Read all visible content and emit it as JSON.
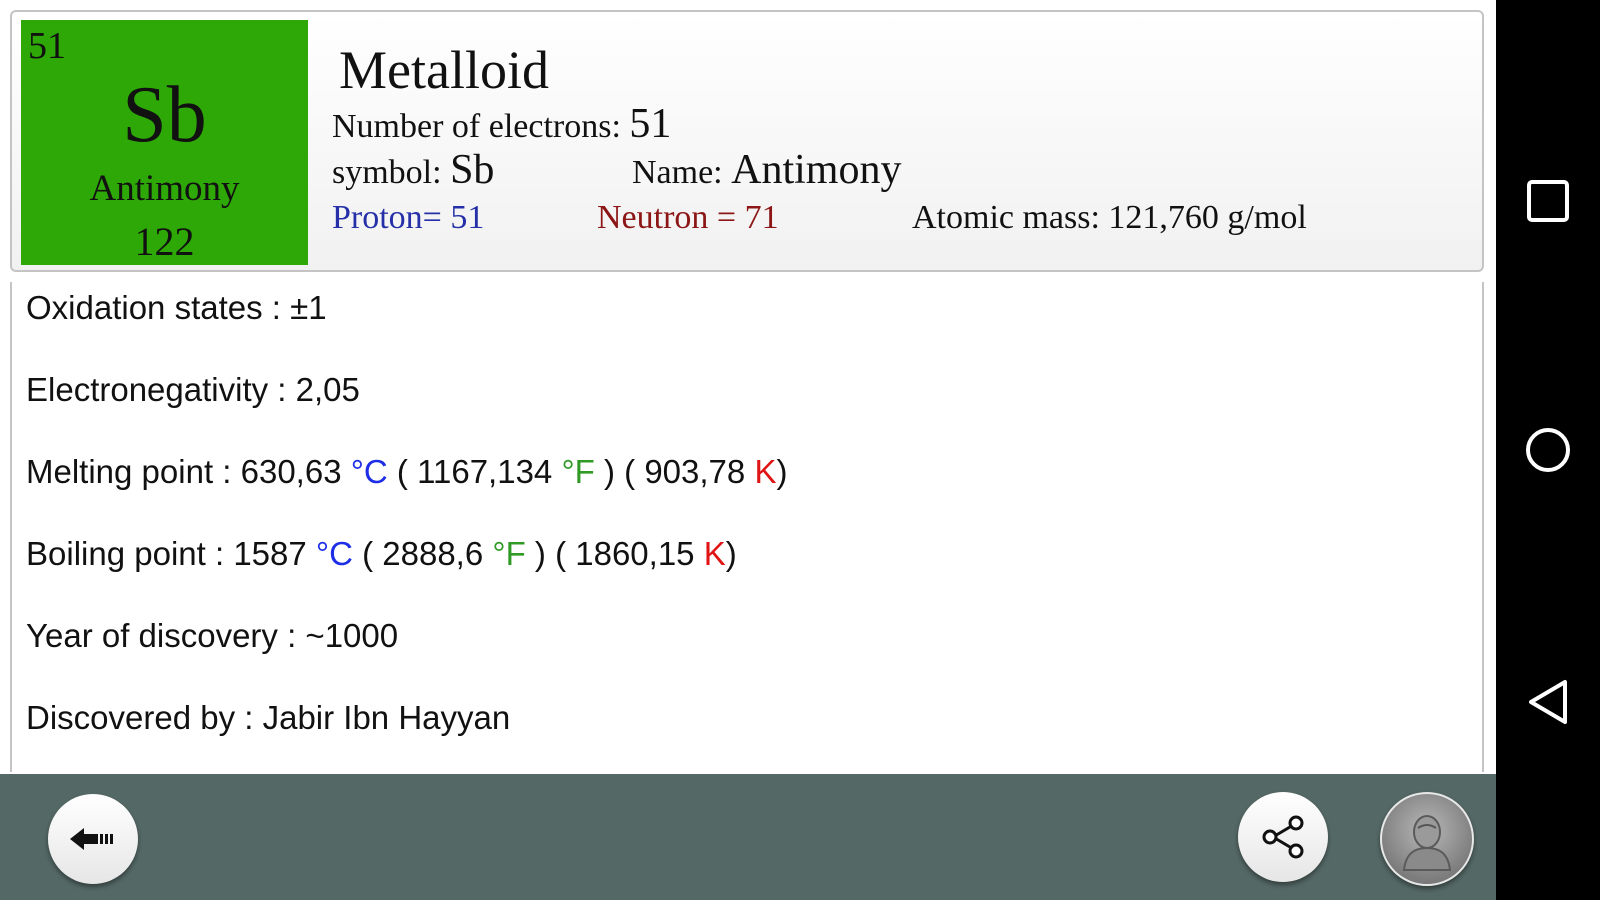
{
  "element": {
    "atomic_number": "51",
    "symbol": "Sb",
    "name": "Antimony",
    "mass_rounded": "122",
    "category": "Metalloid",
    "tile_color": "#2ea806"
  },
  "header": {
    "electrons_label": "Number of electrons: ",
    "electrons_value": "51",
    "symbol_label": "symbol: ",
    "symbol_value": "Sb",
    "name_label": "Name: ",
    "name_value": "Antimony",
    "proton": "Proton= 51",
    "neutron": "Neutron = 71",
    "atomic_mass": "Atomic mass: 121,760 g/mol"
  },
  "properties": {
    "oxidation": "Oxidation states : ±1",
    "electronegativity": "Electronegativity : 2,05",
    "melting": {
      "label": "Melting point : ",
      "c": "630,63",
      "f": "1167,134",
      "k": "903,78"
    },
    "boiling": {
      "label": "Boiling point : ",
      "c": "1587",
      "f": "2888,6",
      "k": "1860,15"
    },
    "units": {
      "c": "°C",
      "f": "°F",
      "k": "K",
      "open": " ( ",
      "close": " )",
      "close_k": ")"
    },
    "year": "Year of discovery : ~1000",
    "discovered_by": "Discovered by : Jabir Ibn Hayyan"
  },
  "toolbar": {
    "back_icon": "back-arrow-icon",
    "share_icon": "share-icon",
    "avatar_icon": "avatar-icon"
  },
  "navbar": {
    "icons": [
      "recents-square-icon",
      "home-circle-icon",
      "back-triangle-icon"
    ]
  },
  "colors": {
    "tile": "#2ea806",
    "proton": "#2530a8",
    "neutron": "#8c1616",
    "celsius": "#1d2ee6",
    "fahrenheit": "#2f9a24",
    "kelvin": "#e01414",
    "toolbar": "#546865"
  }
}
